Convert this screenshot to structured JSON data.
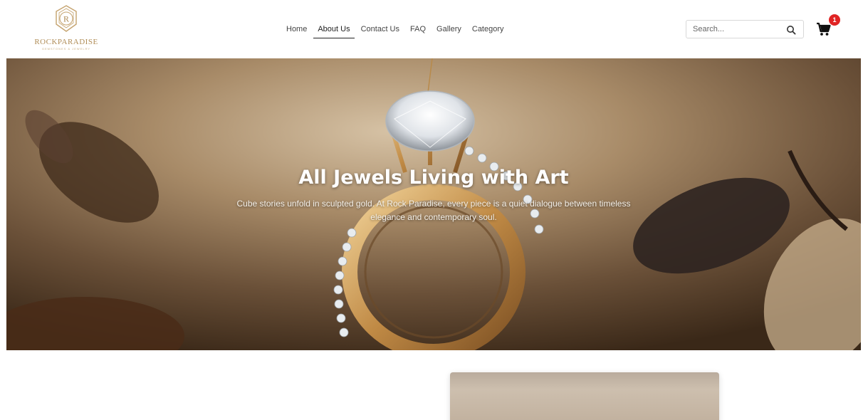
{
  "brand": {
    "name": "ROCKPARADISE",
    "tagline": "GEMSTONES & JEWELRY",
    "accent_color": "#b08d57"
  },
  "nav": {
    "items": [
      {
        "label": "Home"
      },
      {
        "label": "About Us"
      },
      {
        "label": "Contact Us"
      },
      {
        "label": "FAQ"
      },
      {
        "label": "Gallery"
      },
      {
        "label": "Category"
      }
    ],
    "active": "About Us"
  },
  "search": {
    "placeholder": "Search...",
    "icon": "search-icon"
  },
  "cart": {
    "icon": "cart-icon",
    "count": "1",
    "badge_color": "#e02424"
  },
  "hero": {
    "title": "All Jewels Living with Art",
    "subtitle": "Cube stories unfold in sculpted gold. At Rock Paradise, every piece is a quiet dialogue between timeless elegance and contemporary soul."
  }
}
